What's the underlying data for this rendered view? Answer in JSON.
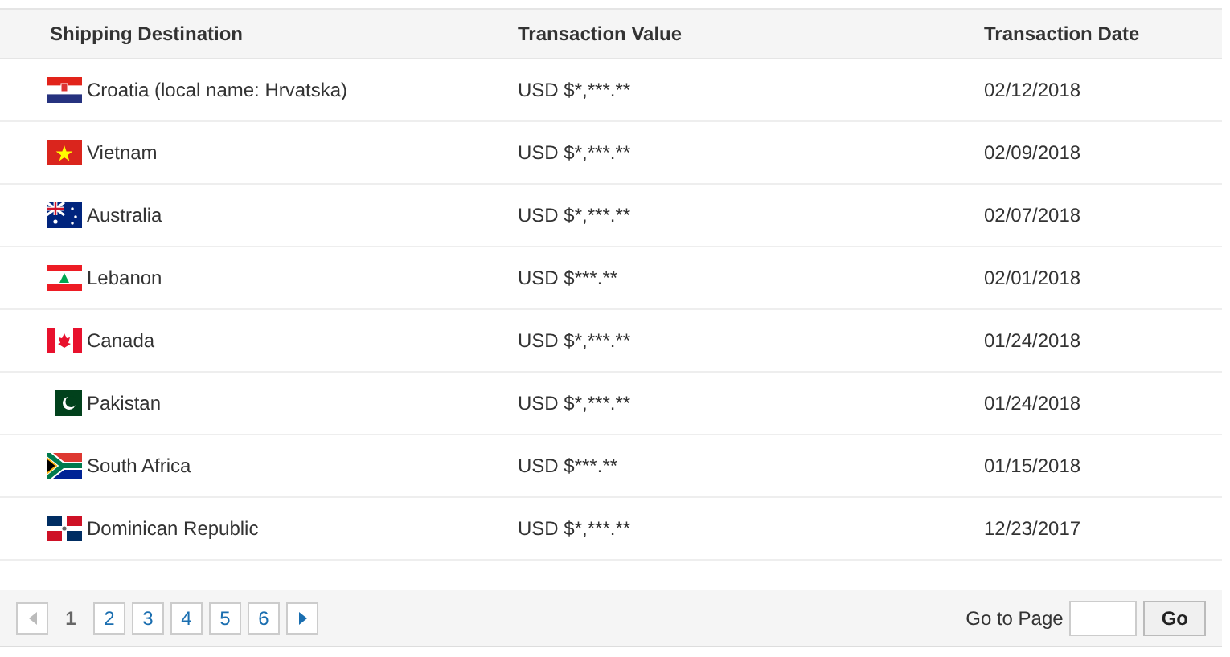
{
  "table": {
    "columns": [
      "Shipping Destination",
      "Transaction Value",
      "Transaction Date"
    ],
    "rows": [
      {
        "kind": "hr",
        "destination": "Croatia (local name: Hrvatska)",
        "value": "USD $*,***.**",
        "date": "02/12/2018"
      },
      {
        "kind": "vn",
        "destination": "Vietnam",
        "value": "USD $*,***.**",
        "date": "02/09/2018"
      },
      {
        "kind": "au",
        "destination": "Australia",
        "value": "USD $*,***.**",
        "date": "02/07/2018"
      },
      {
        "kind": "lb",
        "destination": "Lebanon",
        "value": "USD $***.**",
        "date": "02/01/2018"
      },
      {
        "kind": "ca",
        "destination": "Canada",
        "value": "USD $*,***.**",
        "date": "01/24/2018"
      },
      {
        "kind": "pk",
        "destination": "Pakistan",
        "value": "USD $*,***.**",
        "date": "01/24/2018"
      },
      {
        "kind": "za",
        "destination": "South Africa",
        "value": "USD $***.**",
        "date": "01/15/2018"
      },
      {
        "kind": "do",
        "destination": "Dominican Republic",
        "value": "USD $*,***.**",
        "date": "12/23/2017"
      }
    ]
  },
  "pagination": {
    "prev_disabled": true,
    "pages": [
      {
        "label": "1",
        "selected": true
      },
      {
        "label": "2",
        "selected": false
      },
      {
        "label": "3",
        "selected": false
      },
      {
        "label": "4",
        "selected": false
      },
      {
        "label": "5",
        "selected": false
      },
      {
        "label": "6",
        "selected": false
      }
    ],
    "goto_label": "Go to Page",
    "go_button": "Go"
  }
}
